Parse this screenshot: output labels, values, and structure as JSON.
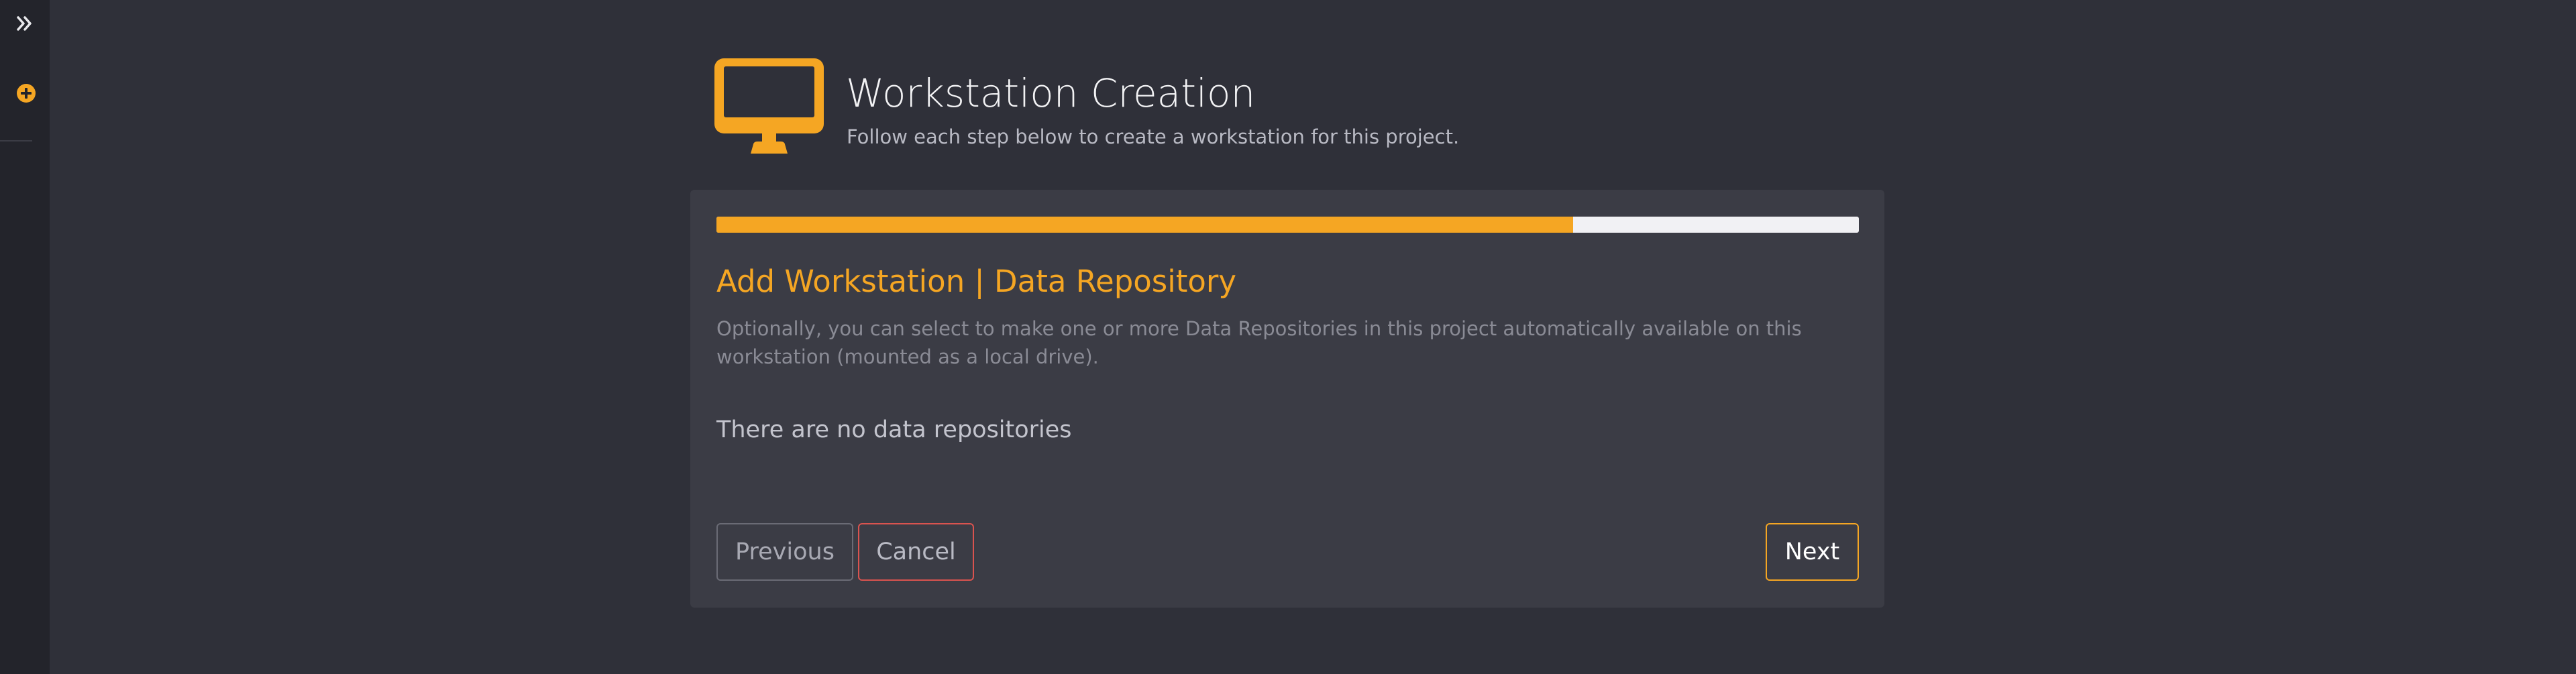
{
  "sidebar": {
    "expand_icon": "double-chevron-right-icon",
    "add_icon": "plus-circle-icon"
  },
  "header": {
    "icon": "monitor-icon",
    "title": "Workstation Creation",
    "subtitle": "Follow each step below to create a workstation for this project."
  },
  "wizard": {
    "progress_percent": 75,
    "step_title": "Add Workstation | Data Repository",
    "description": "Optionally, you can select to make one or more Data Repositories in this project automatically available on this workstation (mounted as a local drive).",
    "empty_message": "There are no data repositories",
    "buttons": {
      "previous": "Previous",
      "cancel": "Cancel",
      "next": "Next"
    }
  },
  "colors": {
    "accent": "#f5a623",
    "cancel_border": "#d9534f",
    "background": "#2f3039",
    "panel": "#3b3c45",
    "sidebar": "#23242b"
  }
}
